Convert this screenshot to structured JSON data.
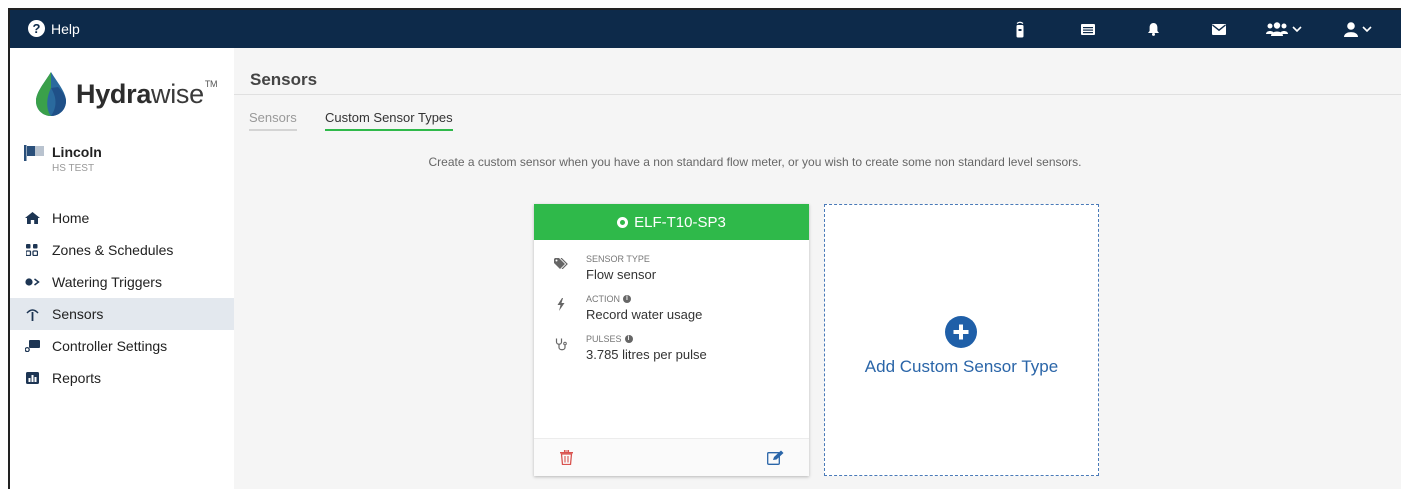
{
  "topbar": {
    "help_label": "Help",
    "icons": [
      "controller-icon",
      "list-icon",
      "bell-icon",
      "envelope-icon",
      "users-icon",
      "user-icon"
    ]
  },
  "sidebar": {
    "brand": {
      "prefix": "Hydra",
      "suffix": "wise",
      "tm": "TM"
    },
    "controller": {
      "name": "Lincoln",
      "subtitle": "HS TEST"
    },
    "items": [
      {
        "label": "Home",
        "icon": "home-icon"
      },
      {
        "label": "Zones & Schedules",
        "icon": "zones-icon"
      },
      {
        "label": "Watering Triggers",
        "icon": "triggers-icon"
      },
      {
        "label": "Sensors",
        "icon": "antenna-icon",
        "active": true
      },
      {
        "label": "Controller Settings",
        "icon": "controller-settings-icon"
      },
      {
        "label": "Reports",
        "icon": "reports-icon"
      }
    ]
  },
  "main": {
    "title": "Sensors",
    "tabs": [
      {
        "label": "Sensors",
        "active": false
      },
      {
        "label": "Custom Sensor Types",
        "active": true
      }
    ],
    "intro": "Create a custom sensor when you have a non standard flow meter, or you wish to create some non standard level sensors.",
    "sensor_card": {
      "name": "ELF-T10-SP3",
      "fields": [
        {
          "label": "SENSOR TYPE",
          "value": "Flow sensor",
          "icon": "tags-icon",
          "info": false
        },
        {
          "label": "ACTION",
          "value": "Record water usage",
          "icon": "bolt-icon",
          "info": true
        },
        {
          "label": "PULSES",
          "value": "3.785 litres per pulse",
          "icon": "stethoscope-icon",
          "info": true
        }
      ]
    },
    "add_card": {
      "label": "Add Custom Sensor Type"
    }
  },
  "colors": {
    "topbar": "#0d2a4a",
    "green": "#2fb94a",
    "blue": "#2a65a8",
    "delete": "#d9534f"
  }
}
